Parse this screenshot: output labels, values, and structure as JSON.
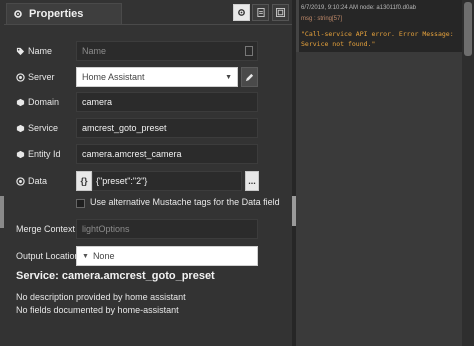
{
  "header": {
    "title": "Properties"
  },
  "form": {
    "name": {
      "label": "Name",
      "placeholder": "Name"
    },
    "server": {
      "label": "Server",
      "value": "Home Assistant"
    },
    "domain": {
      "label": "Domain",
      "value": "camera"
    },
    "service": {
      "label": "Service",
      "value": "amcrest_goto_preset"
    },
    "entity": {
      "label": "Entity Id",
      "value": "camera.amcrest_camera"
    },
    "data": {
      "label": "Data",
      "type_label": "{}",
      "value": "{\"preset\":\"2\"}",
      "expand_label": "..."
    },
    "mustache": {
      "label": "Use alternative Mustache tags for the Data field",
      "checked": false
    },
    "merge_context": {
      "label": "Merge Context",
      "placeholder": "lightOptions"
    },
    "output_location": {
      "label": "Output Location",
      "value": "None"
    }
  },
  "service_info": {
    "title": "Service: camera.amcrest_goto_preset",
    "description": "No description provided by home assistant",
    "fields": "No fields documented by home-assistant"
  },
  "debug": {
    "meta": "6/7/2019, 9:10:24 AM    node: a13011f0.d0ab",
    "type": "msg : string[57]",
    "message": "\"Call-service API error. Error Message: Service not found.\""
  },
  "colors": {
    "panel_bg": "#333333",
    "debug_bg": "#262626",
    "debug_text": "#e8a33c",
    "input_bg": "#2b2b2b"
  }
}
